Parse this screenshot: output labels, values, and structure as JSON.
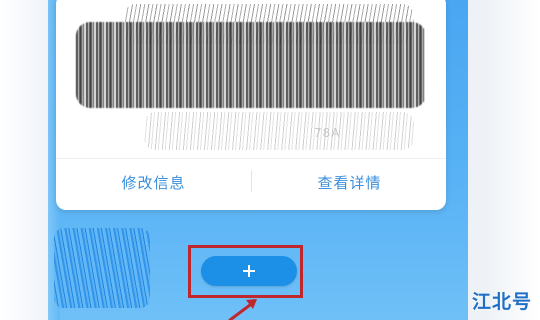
{
  "card": {
    "partial_text": "78A",
    "actions": {
      "edit_label": "修改信息",
      "view_label": "查看详情"
    }
  },
  "add_button": {
    "icon": "plus-icon"
  },
  "annotation": {
    "highlight_color": "#c0272d",
    "arrow_color": "#c0272d"
  },
  "watermark": {
    "text": "江北号"
  },
  "colors": {
    "background_blue": "#4aa6f1",
    "button_blue": "#1c8fe6",
    "link_blue": "#3b8fdc",
    "card_white": "#ffffff"
  }
}
